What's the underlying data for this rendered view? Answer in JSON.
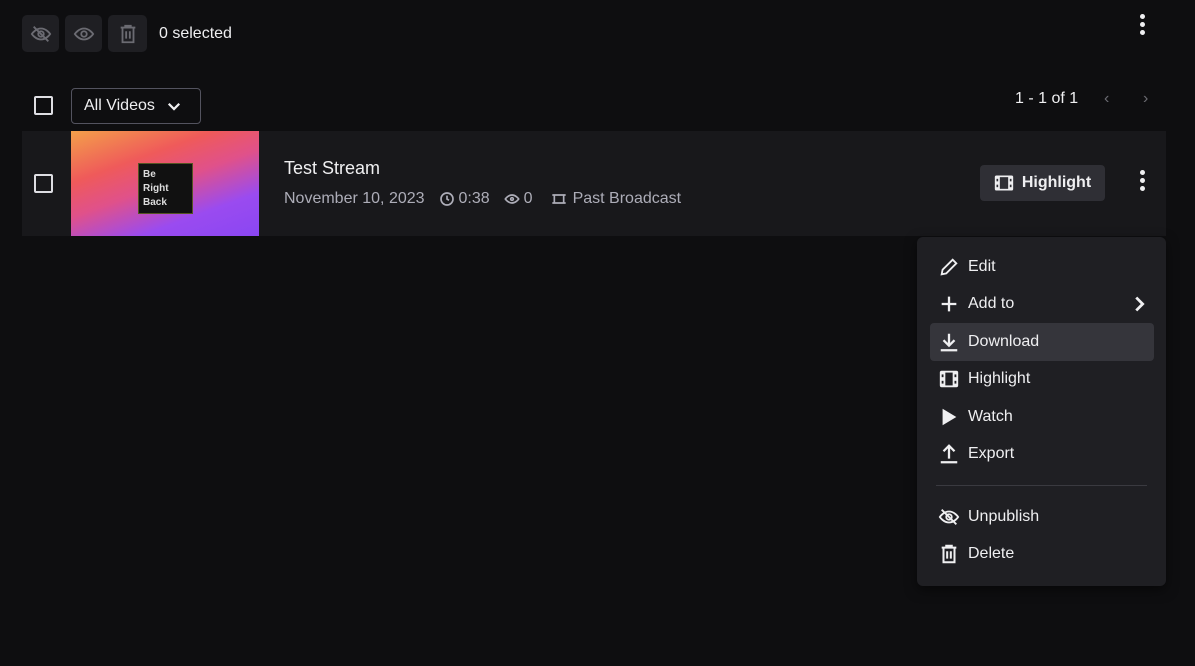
{
  "toolbar": {
    "selected_count": "0 selected",
    "buttons": [
      "unpublish-icon",
      "publish-icon",
      "delete-icon"
    ]
  },
  "filter": {
    "selected": "All Videos"
  },
  "pagination": {
    "text": "1 - 1 of 1"
  },
  "video": {
    "title": "Test Stream",
    "date": "November 10, 2023",
    "duration": "0:38",
    "views": "0",
    "type": "Past Broadcast",
    "thumbnail_text": [
      "Be",
      "Right",
      "Back"
    ],
    "highlight_label": "Highlight"
  },
  "menu": {
    "items": [
      {
        "label": "Edit",
        "icon": "pencil-icon"
      },
      {
        "label": "Add to",
        "icon": "plus-icon"
      },
      {
        "label": "Download",
        "icon": "download-icon"
      },
      {
        "label": "Highlight",
        "icon": "film-icon"
      },
      {
        "label": "Watch",
        "icon": "play-icon"
      },
      {
        "label": "Export",
        "icon": "upload-icon"
      },
      {
        "label": "Unpublish",
        "icon": "eye-off-icon"
      },
      {
        "label": "Delete",
        "icon": "trash-icon"
      }
    ]
  },
  "colors": {
    "background": "#0e0e10",
    "row": "#18181b",
    "menu": "#1f1f23",
    "hover": "#35353b"
  }
}
